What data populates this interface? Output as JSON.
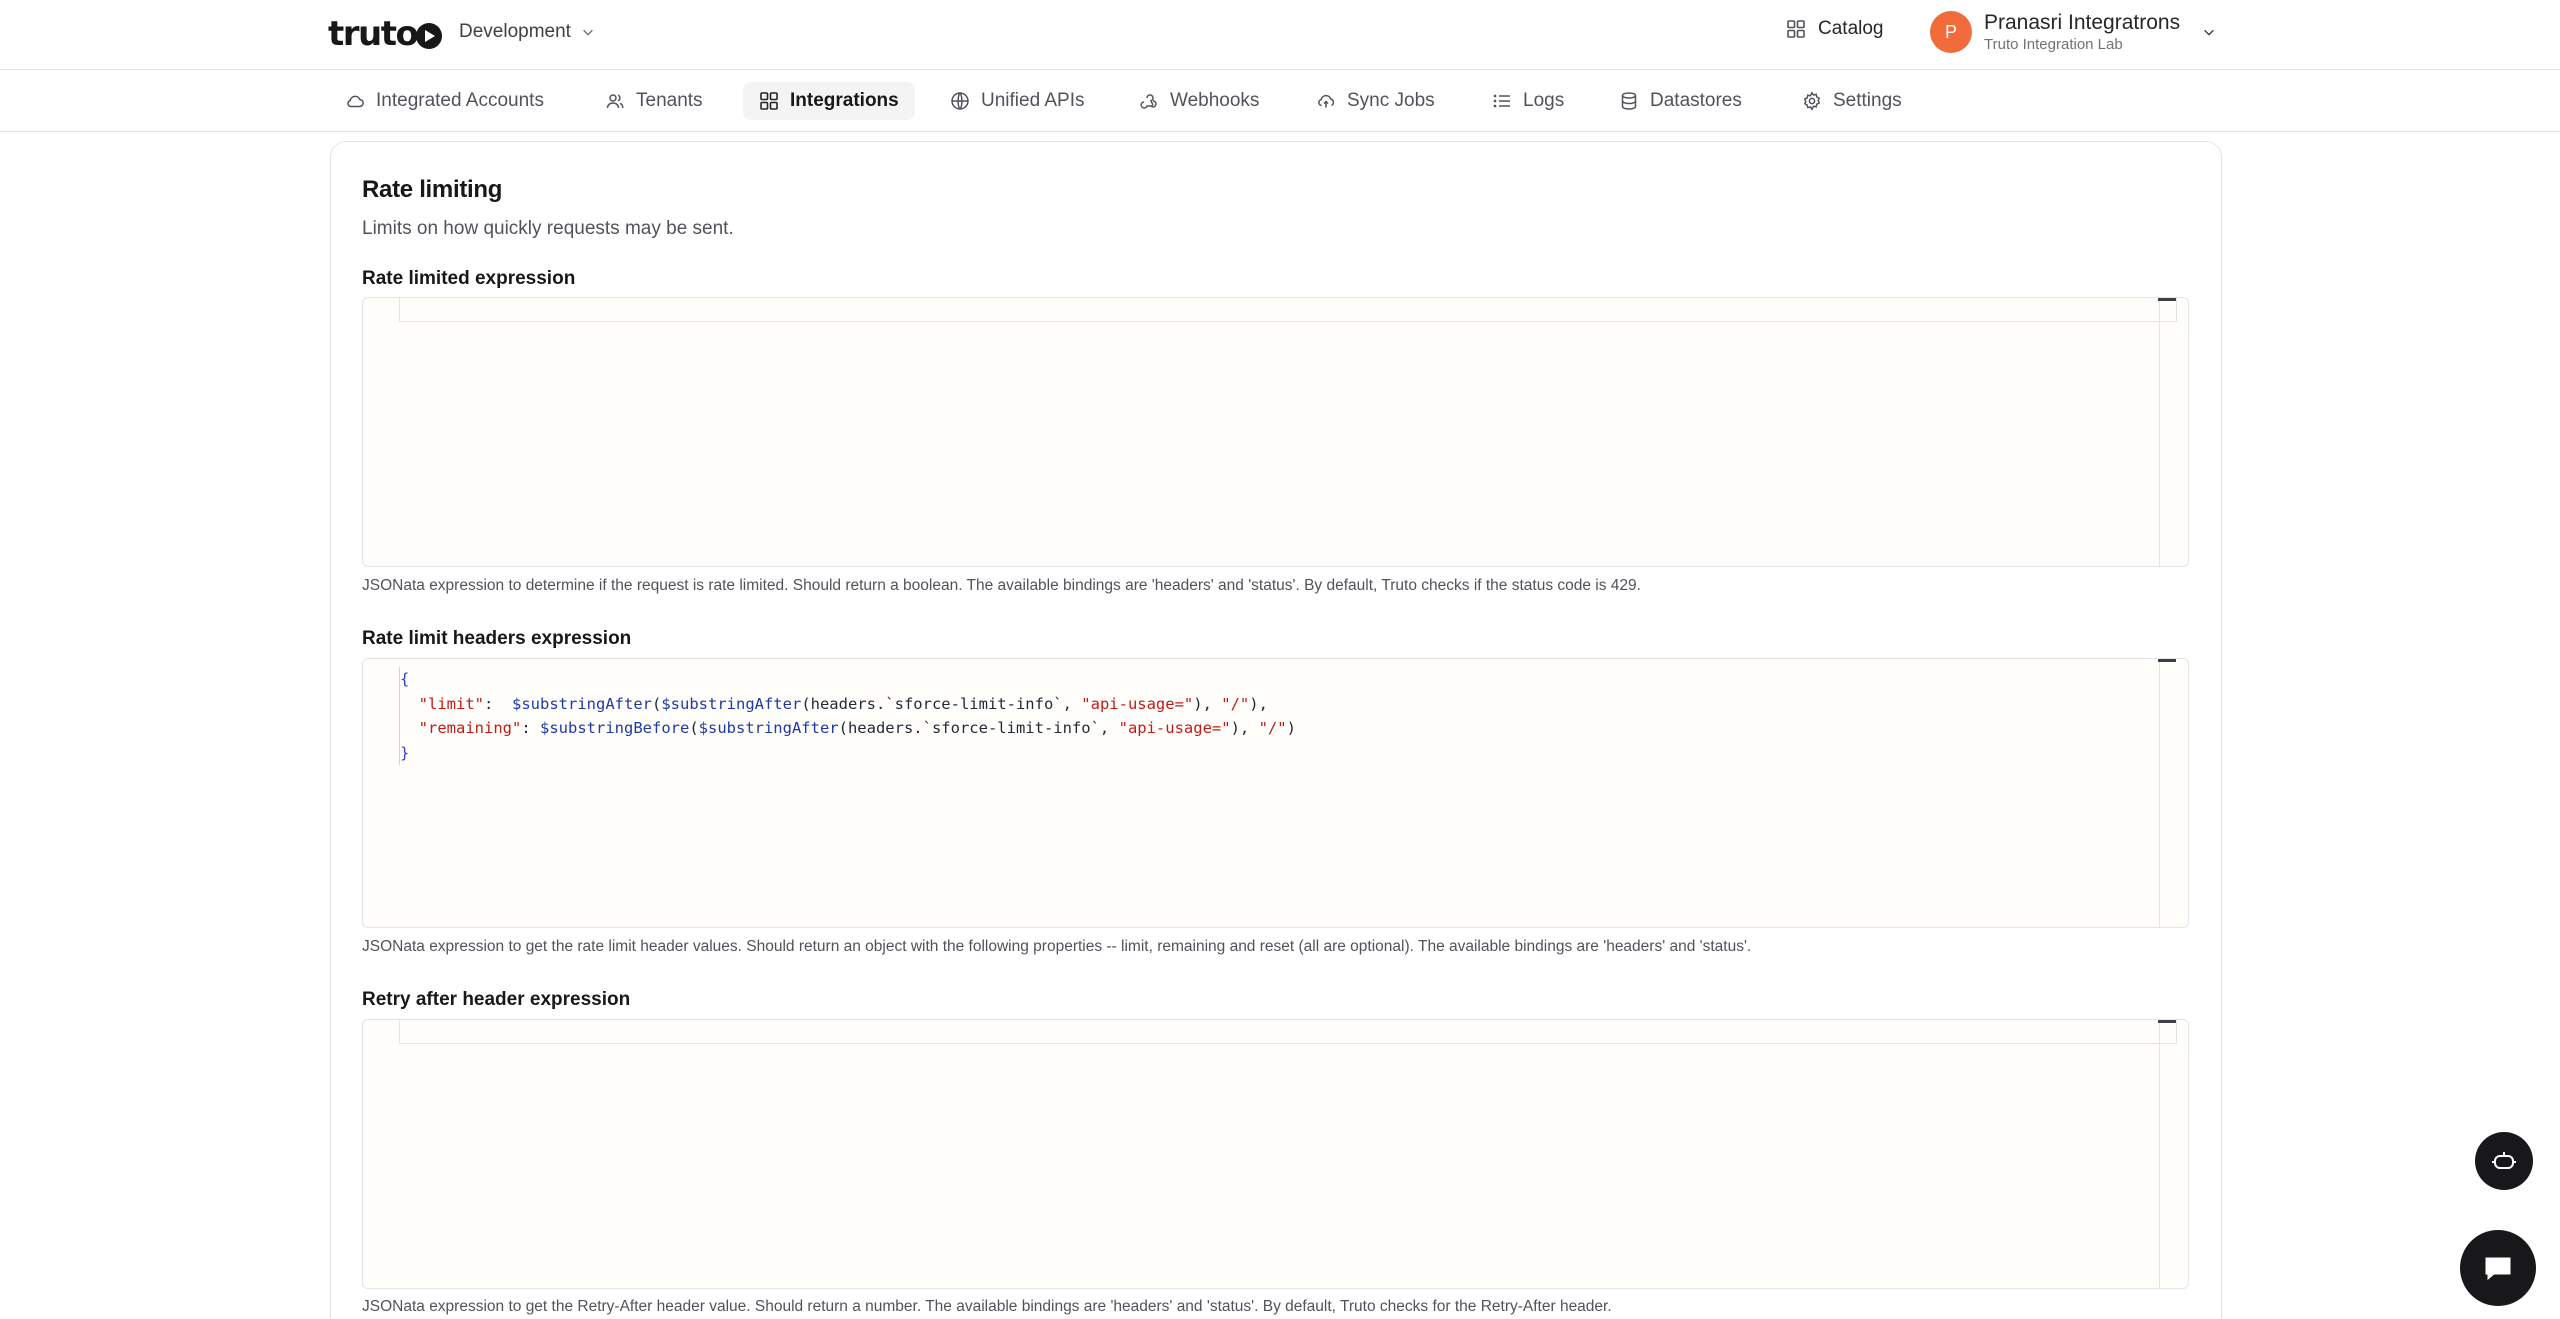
{
  "header": {
    "logo_text": "truto",
    "environment": "Development",
    "catalog_label": "Catalog",
    "user": {
      "initial": "P",
      "name": "Pranasri Integratrons",
      "org": "Truto Integration Lab"
    }
  },
  "nav": {
    "items": [
      {
        "label": "Integrated Accounts",
        "icon": "cloud-icon"
      },
      {
        "label": "Tenants",
        "icon": "users-icon"
      },
      {
        "label": "Integrations",
        "icon": "grid-icon",
        "active": true
      },
      {
        "label": "Unified APIs",
        "icon": "globe-icon"
      },
      {
        "label": "Webhooks",
        "icon": "webhook-icon"
      },
      {
        "label": "Sync Jobs",
        "icon": "cloud-sync-icon"
      },
      {
        "label": "Logs",
        "icon": "list-icon"
      },
      {
        "label": "Datastores",
        "icon": "database-icon"
      },
      {
        "label": "Settings",
        "icon": "gear-icon"
      }
    ]
  },
  "section": {
    "title": "Rate limiting",
    "description": "Limits on how quickly requests may be sent.",
    "fields": [
      {
        "label": "Rate limited expression",
        "value": "",
        "help": "JSONata expression to determine if the request is rate limited. Should return a boolean. The available bindings are 'headers' and 'status'. By default, Truto checks if the status code is 429."
      },
      {
        "label": "Rate limit headers expression",
        "code_lines": [
          "{",
          "  \"limit\":  $substringAfter($substringAfter(headers.`sforce-limit-info`, \"api-usage=\"), \"/\"),",
          "  \"remaining\": $substringBefore($substringAfter(headers.`sforce-limit-info`, \"api-usage=\"), \"/\")",
          "}"
        ],
        "help": "JSONata expression to get the rate limit header values. Should return an object with the following properties -- limit, remaining and reset (all are optional). The available bindings are 'headers' and 'status'."
      },
      {
        "label": "Retry after header expression",
        "value": "",
        "help": "JSONata expression to get the Retry-After header value. Should return a number. The available bindings are 'headers' and 'status'. By default, Truto checks for the Retry-After header."
      }
    ]
  },
  "floating": {
    "assistant_icon": "bot-icon",
    "chat_icon": "chat-icon"
  },
  "colors": {
    "accent_avatar": "#f26b3a",
    "active_tab_bg": "#f4f4f5",
    "editor_bg": "#fffefb",
    "code_string": "#c41a16",
    "code_function": "#1e3aa8",
    "code_brace": "#2f3ec4"
  }
}
